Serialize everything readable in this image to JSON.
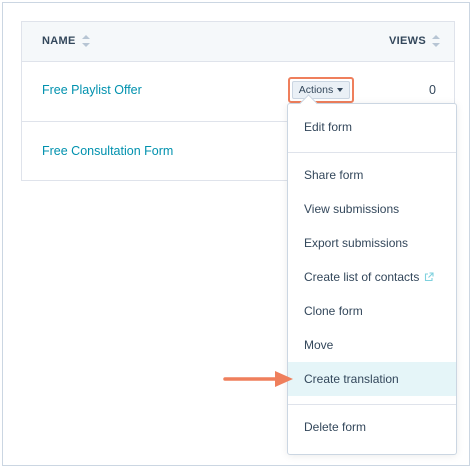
{
  "table": {
    "headers": {
      "name": "NAME",
      "views": "VIEWS"
    },
    "rows": [
      {
        "name": "Free Playlist Offer",
        "views": "0"
      },
      {
        "name": "Free Consultation Form"
      }
    ],
    "actions_label": "Actions"
  },
  "menu": {
    "items": [
      "Edit form",
      "Share form",
      "View submissions",
      "Export submissions",
      "Create list of contacts",
      "Clone form",
      "Move",
      "Create translation",
      "Delete form"
    ]
  },
  "colors": {
    "link": "#0091ae",
    "highlight_border": "#ef7f5c",
    "annotation_arrow": "#ef7f5c",
    "hover_bg": "#e5f5f8"
  }
}
